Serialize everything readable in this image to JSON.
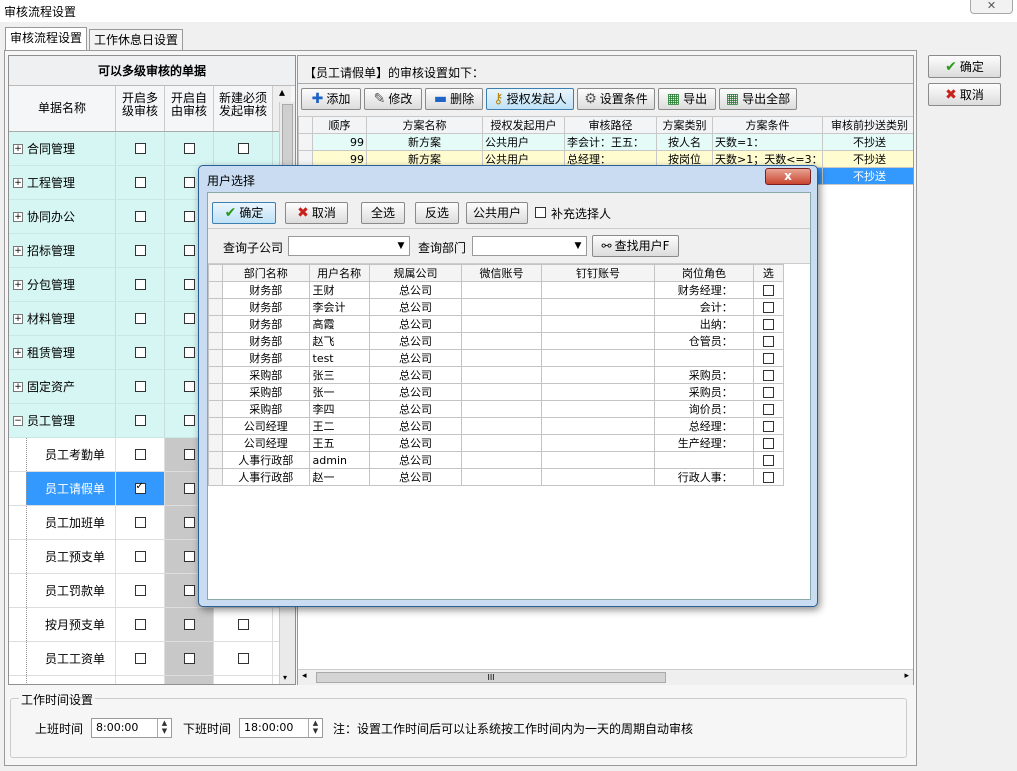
{
  "window": {
    "title": "审核流程设置"
  },
  "tabs": [
    {
      "label": "审核流程设置"
    },
    {
      "label": "工作休息日设置"
    }
  ],
  "side_buttons": {
    "ok": "确定",
    "cancel": "取消"
  },
  "left": {
    "title": "可以多级审核的单据",
    "columns": [
      "单据名称",
      "开启多级审核",
      "开启自由审核",
      "新建必须发起审核"
    ],
    "groups": [
      {
        "label": "合同管理",
        "expand": "+"
      },
      {
        "label": "工程管理",
        "expand": "+"
      },
      {
        "label": "协同办公",
        "expand": "+"
      },
      {
        "label": "招标管理",
        "expand": "+"
      },
      {
        "label": "分包管理",
        "expand": "+"
      },
      {
        "label": "材料管理",
        "expand": "+"
      },
      {
        "label": "租赁管理",
        "expand": "+"
      },
      {
        "label": "固定资产",
        "expand": "+"
      },
      {
        "label": "员工管理",
        "expand": "−"
      }
    ],
    "children": [
      {
        "label": "员工考勤单",
        "checked": false
      },
      {
        "label": "员工请假单",
        "checked": true
      },
      {
        "label": "员工加班单",
        "checked": false
      },
      {
        "label": "员工预支单",
        "checked": false
      },
      {
        "label": "员工罚款单",
        "checked": false
      },
      {
        "label": "按月预支单",
        "checked": false
      },
      {
        "label": "员工工资单",
        "checked": false
      },
      {
        "label": "员工派工单",
        "checked": false
      }
    ]
  },
  "right": {
    "heading": "【员工请假单】的审核设置如下：",
    "toolbar": [
      "添加",
      "修改",
      "删除",
      "授权发起人",
      "设置条件",
      "导出",
      "导出全部"
    ],
    "columns": [
      "顺序",
      "方案名称",
      "授权发起用户",
      "审核路径",
      "方案类别",
      "方案条件",
      "审核前抄送类别"
    ],
    "rows": [
      [
        "99",
        "新方案",
        "公共用户",
        "李会计：王五：",
        "按人名",
        "天数=1：",
        "不抄送"
      ],
      [
        "99",
        "新方案",
        "公共用户",
        "总经理：",
        "按岗位",
        "天数>1；天数<=3：",
        "不抄送"
      ],
      [
        "",
        "",
        "",
        "",
        "",
        "",
        "不抄送"
      ]
    ],
    "hscroll": "III"
  },
  "work_time": {
    "group_title": "工作时间设置",
    "start_label": "上班时间",
    "start_value": "8:00:00",
    "end_label": "下班时间",
    "end_value": "18:00:00",
    "note": "注：设置工作时间后可以让系统按工作时间内为一天的周期自动审核"
  },
  "dialog": {
    "title": "用户选择",
    "close": "x",
    "buttons": {
      "ok": "确定",
      "cancel": "取消",
      "select_all": "全选",
      "invert": "反选",
      "public": "公共用户"
    },
    "supplement": "补充选择人",
    "sub_company_label": "查询子公司",
    "department_label": "查询部门",
    "find_button": "查找用户F",
    "columns": [
      "部门名称",
      "用户名称",
      "规属公司",
      "微信账号",
      "钉钉账号",
      "岗位角色",
      "选"
    ],
    "users": [
      [
        "财务部",
        "王财",
        "总公司",
        "",
        "",
        "财务经理："
      ],
      [
        "财务部",
        "李会计",
        "总公司",
        "",
        "",
        "会计："
      ],
      [
        "财务部",
        "高霞",
        "总公司",
        "",
        "",
        "出纳："
      ],
      [
        "财务部",
        "赵飞",
        "总公司",
        "",
        "",
        "仓管员："
      ],
      [
        "财务部",
        "test",
        "总公司",
        "",
        "",
        ""
      ],
      [
        "采购部",
        "张三",
        "总公司",
        "",
        "",
        "采购员："
      ],
      [
        "采购部",
        "张一",
        "总公司",
        "",
        "",
        "采购员："
      ],
      [
        "采购部",
        "李四",
        "总公司",
        "",
        "",
        "询价员："
      ],
      [
        "公司经理",
        "王二",
        "总公司",
        "",
        "",
        "总经理："
      ],
      [
        "公司经理",
        "王五",
        "总公司",
        "",
        "",
        "生产经理："
      ],
      [
        "人事行政部",
        "admin",
        "总公司",
        "",
        "",
        ""
      ],
      [
        "人事行政部",
        "赵一",
        "总公司",
        "",
        "",
        "行政人事："
      ]
    ]
  },
  "colors": {
    "accent_blue": "#3399ff",
    "tree_bg": "#d6f6f3",
    "row_yellow": "#fffcd0",
    "dialog_frame": "#c9dcf1"
  }
}
